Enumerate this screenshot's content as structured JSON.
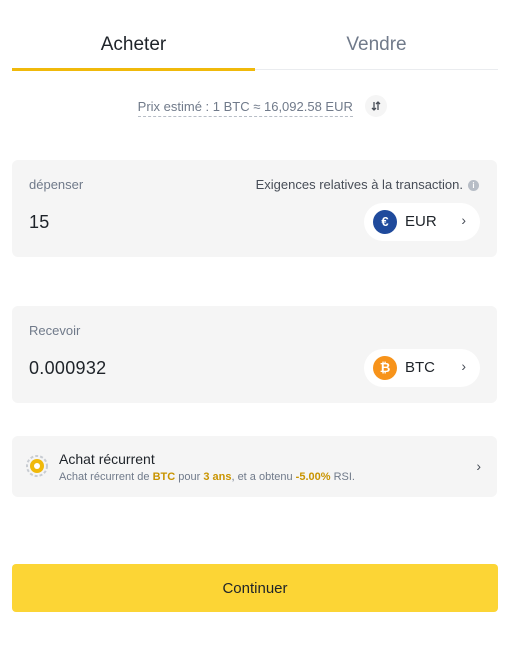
{
  "tabs": {
    "buy_label": "Acheter",
    "sell_label": "Vendre"
  },
  "price": {
    "text": "Prix estimé : 1 BTC ≈ 16,092.58 EUR"
  },
  "spend": {
    "label": "dépenser",
    "hint": "Exigences relatives à la transaction.",
    "amount": "15",
    "currency": "EUR",
    "currency_icon": "euro-icon",
    "coin_symbol": "€",
    "coin_color": "#1f4a9c"
  },
  "receive": {
    "label": "Recevoir",
    "amount": "0.000932",
    "currency": "BTC",
    "currency_icon": "bitcoin-icon",
    "coin_symbol": "₿",
    "coin_color": "#f7931a"
  },
  "recurring": {
    "title": "Achat récurrent",
    "desc_prefix": "Achat récurrent de ",
    "desc_coin": "BTC",
    "desc_mid1": " pour ",
    "desc_period": "3 ans",
    "desc_mid2": ", et a obtenu ",
    "desc_pct": "-5.00%",
    "desc_suffix": " RSI."
  },
  "actions": {
    "continue_label": "Continuer"
  },
  "colors": {
    "accent": "#f0b90b",
    "button": "#fcd535",
    "highlight_text": "#c99400"
  }
}
